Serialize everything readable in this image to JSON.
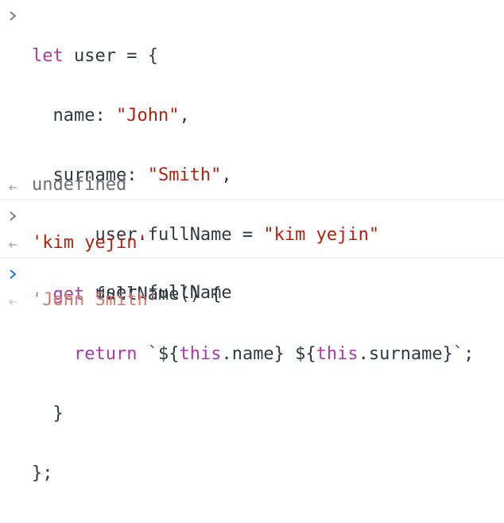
{
  "colors": {
    "keyword": "#a83aa9",
    "string": "#b5200d",
    "text": "#303942",
    "undefined": "#6e6e6e",
    "eager_eval": "#d47b6f",
    "active_prompt": "#1a73e8",
    "prompt": "#7d7d7d",
    "divider": "#e3e3e3"
  },
  "icons": {
    "input_prompt": "chevron-right-icon",
    "result_prompt": "return-arrow-icon"
  },
  "entries": [
    {
      "input": {
        "line1": {
          "kw": "let",
          "rest": " user = {"
        },
        "line2": {
          "key": "  name: ",
          "str": "\"John\"",
          "tail": ","
        },
        "line3": {
          "key": "  surname: ",
          "str": "\"Smith\"",
          "tail": ","
        },
        "line5": {
          "indent": "  ",
          "kw": "get",
          "rest": " fullName() {"
        },
        "line6": {
          "indent": "    ",
          "kw_return": "return",
          "sp": " ",
          "tick_open": "`",
          "part1": "${",
          "this1": "this",
          "part2": ".name} ${",
          "this2": "this",
          "part3": ".surname}",
          "tick_close": "`",
          "semi": ";"
        },
        "line7": "  }",
        "line8": "};"
      },
      "result": "undefined"
    },
    {
      "input": {
        "lhs": "user.fullName = ",
        "str": "\"kim yejin\""
      },
      "result": "'kim yejin'"
    },
    {
      "input": {
        "text": "user.fullName"
      },
      "result": "'John Smith'"
    }
  ]
}
